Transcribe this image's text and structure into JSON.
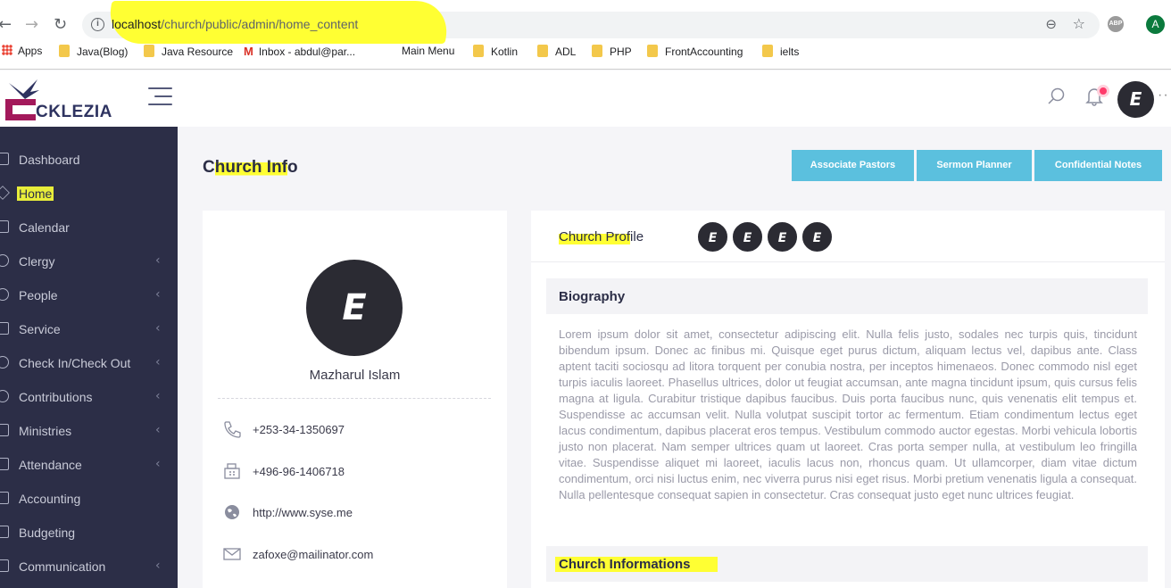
{
  "browser": {
    "url_host": "localhost",
    "url_path": "/church/public/admin/home_content",
    "profile_initial": "A",
    "extension_label": "ABP",
    "bookmarks": [
      {
        "label": "Apps",
        "kind": "apps"
      },
      {
        "label": "Java(Blog)",
        "kind": "folder"
      },
      {
        "label": "Java Resource",
        "kind": "folder"
      },
      {
        "label": "Inbox - abdul@par...",
        "kind": "gmail"
      },
      {
        "label": "Main Menu",
        "kind": "plain"
      },
      {
        "label": "Kotlin",
        "kind": "folder"
      },
      {
        "label": "ADL",
        "kind": "folder"
      },
      {
        "label": "PHP",
        "kind": "folder"
      },
      {
        "label": "FrontAccounting",
        "kind": "folder"
      },
      {
        "label": "ielts",
        "kind": "folder"
      }
    ]
  },
  "header": {
    "logo_text": "CKLEZIA",
    "avatar_initial": "E"
  },
  "sidebar": {
    "items": [
      {
        "label": "Dashboard",
        "icon": "dashboard-icon",
        "has_submenu": false
      },
      {
        "label": "Home",
        "icon": "home-icon",
        "has_submenu": false,
        "active": true
      },
      {
        "label": "Calendar",
        "icon": "calendar-icon",
        "has_submenu": false
      },
      {
        "label": "Clergy",
        "icon": "clergy-icon",
        "has_submenu": true
      },
      {
        "label": "People",
        "icon": "people-icon",
        "has_submenu": true
      },
      {
        "label": "Service",
        "icon": "service-icon",
        "has_submenu": true
      },
      {
        "label": "Check In/Check Out",
        "icon": "checkin-icon",
        "has_submenu": true
      },
      {
        "label": "Contributions",
        "icon": "contributions-icon",
        "has_submenu": true
      },
      {
        "label": "Ministries",
        "icon": "ministries-icon",
        "has_submenu": true
      },
      {
        "label": "Attendance",
        "icon": "attendance-icon",
        "has_submenu": true
      },
      {
        "label": "Accounting",
        "icon": "accounting-icon",
        "has_submenu": false
      },
      {
        "label": "Budgeting",
        "icon": "budgeting-icon",
        "has_submenu": false
      },
      {
        "label": "Communication",
        "icon": "communication-icon",
        "has_submenu": true
      }
    ],
    "chevron": "‹"
  },
  "main": {
    "title_pre": "C",
    "title_hl": "hurch Inf",
    "title_post": "o",
    "actions": [
      "Associate Pastors",
      "Sermon Planner",
      "Confidential Notes"
    ],
    "profile_card": {
      "avatar_initial": "E",
      "name": "Mazharul Islam",
      "phone": "+253-34-1350697",
      "fax": "+496-96-1406718",
      "website": "http://www.syse.me",
      "email": "zafoxe@mailinator.com"
    },
    "church_profile": {
      "title_hl": "Church Prof",
      "title_post": "ile",
      "avatars": [
        "E",
        "E",
        "E",
        "E"
      ],
      "biography_title": "Biography",
      "biography_text": "Lorem ipsum dolor sit amet, consectetur adipiscing elit. Nulla felis justo, sodales nec turpis quis, tincidunt bibendum ipsum. Donec ac finibus mi. Quisque eget purus dictum, aliquam lectus vel, dapibus ante. Class aptent taciti sociosqu ad litora torquent per conubia nostra, per inceptos himenaeos. Donec commodo nisl eget turpis iaculis laoreet. Phasellus ultrices, dolor ut feugiat accumsan, ante magna tincidunt ipsum, quis cursus felis magna at ligula. Curabitur tristique dapibus faucibus. Duis porta faucibus nunc, quis venenatis elit tempus et. Suspendisse ac accumsan velit. Nulla volutpat suscipit tortor ac fermentum. Etiam condimentum lectus eget lacus condimentum, dapibus placerat eros tempus. Vestibulum commodo auctor egestas. Morbi vehicula lobortis justo non placerat. Nam semper ultrices quam ut laoreet. Cras porta semper nulla, at vestibulum leo fringilla vitae. Suspendisse aliquet mi laoreet, iaculis lacus non, rhoncus quam. Ut ullamcorper, diam vitae dictum condimentum, orci nisi luctus enim, nec viverra purus nisi eget risus. Morbi pretium venenatis ligula a consequat. Nulla pellentesque consequat sapien in consectetur. Cras consequat justo eget nunc ultrices feugiat.",
      "church_info_title": "Church Informations"
    }
  },
  "colors": {
    "sidebar_bg": "#2c2e47",
    "accent_button": "#5bc0de",
    "highlight": "#ffff33"
  }
}
